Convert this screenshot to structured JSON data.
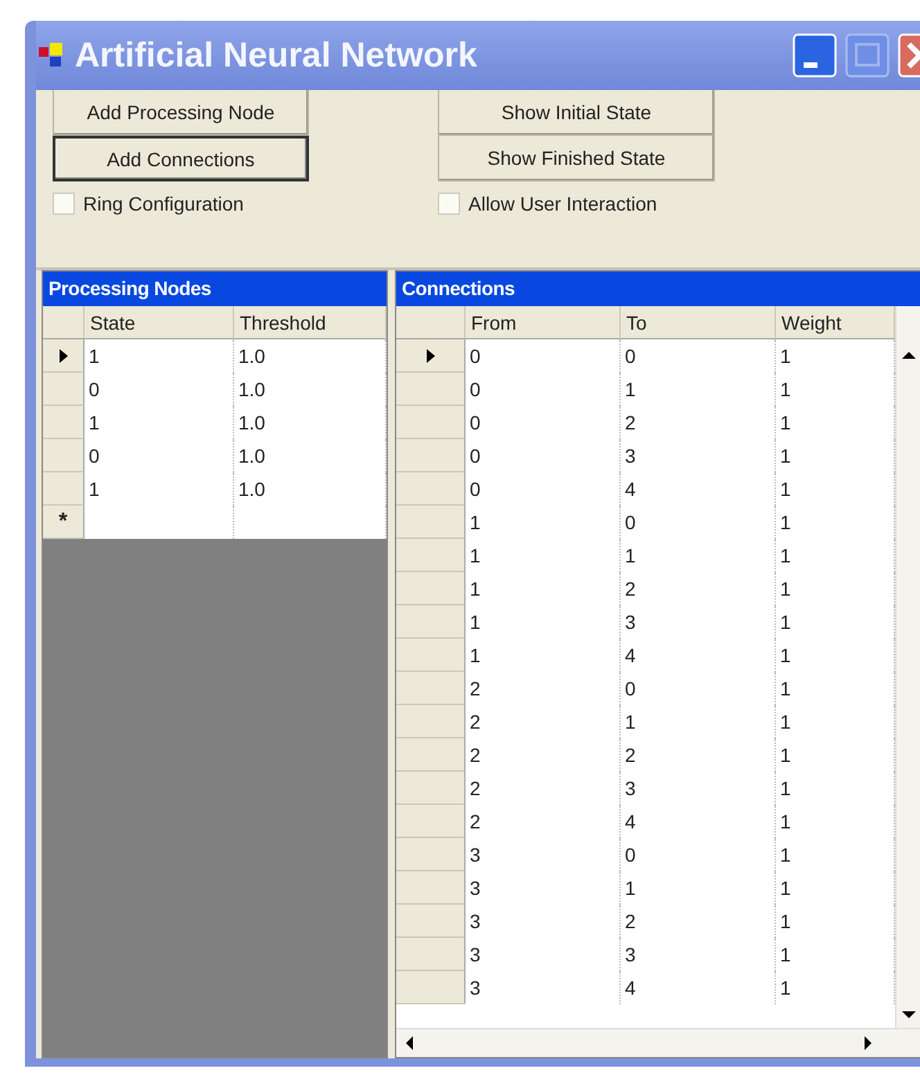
{
  "window": {
    "title": "Artificial Neural Network"
  },
  "control_groups": [
    {
      "buttons": [
        {
          "label": "Add Processing Node",
          "focused": false
        },
        {
          "label": "Add Connections",
          "focused": true
        }
      ],
      "checkbox": {
        "label": "Ring Configuration",
        "checked": false
      }
    },
    {
      "buttons": [
        {
          "label": "Show Initial State",
          "focused": false
        },
        {
          "label": "Show Finished State",
          "focused": false
        }
      ],
      "checkbox": {
        "label": "Allow User Interaction",
        "checked": false
      }
    }
  ],
  "processing_nodes": {
    "title": "Processing Nodes",
    "columns": [
      "State",
      "Threshold"
    ],
    "new_row_marker": "*",
    "rows": [
      {
        "selected": true,
        "cells": [
          "1",
          "1.0"
        ]
      },
      {
        "selected": false,
        "cells": [
          "0",
          "1.0"
        ]
      },
      {
        "selected": false,
        "cells": [
          "1",
          "1.0"
        ]
      },
      {
        "selected": false,
        "cells": [
          "0",
          "1.0"
        ]
      },
      {
        "selected": false,
        "cells": [
          "1",
          "1.0"
        ]
      }
    ]
  },
  "connections": {
    "title": "Connections",
    "columns": [
      "From",
      "To",
      "Weight"
    ],
    "rows": [
      {
        "selected": true,
        "cells": [
          "0",
          "0",
          "1"
        ]
      },
      {
        "selected": false,
        "cells": [
          "0",
          "1",
          "1"
        ]
      },
      {
        "selected": false,
        "cells": [
          "0",
          "2",
          "1"
        ]
      },
      {
        "selected": false,
        "cells": [
          "0",
          "3",
          "1"
        ]
      },
      {
        "selected": false,
        "cells": [
          "0",
          "4",
          "1"
        ]
      },
      {
        "selected": false,
        "cells": [
          "1",
          "0",
          "1"
        ]
      },
      {
        "selected": false,
        "cells": [
          "1",
          "1",
          "1"
        ]
      },
      {
        "selected": false,
        "cells": [
          "1",
          "2",
          "1"
        ]
      },
      {
        "selected": false,
        "cells": [
          "1",
          "3",
          "1"
        ]
      },
      {
        "selected": false,
        "cells": [
          "1",
          "4",
          "1"
        ]
      },
      {
        "selected": false,
        "cells": [
          "2",
          "0",
          "1"
        ]
      },
      {
        "selected": false,
        "cells": [
          "2",
          "1",
          "1"
        ]
      },
      {
        "selected": false,
        "cells": [
          "2",
          "2",
          "1"
        ]
      },
      {
        "selected": false,
        "cells": [
          "2",
          "3",
          "1"
        ]
      },
      {
        "selected": false,
        "cells": [
          "2",
          "4",
          "1"
        ]
      },
      {
        "selected": false,
        "cells": [
          "3",
          "0",
          "1"
        ]
      },
      {
        "selected": false,
        "cells": [
          "3",
          "1",
          "1"
        ]
      },
      {
        "selected": false,
        "cells": [
          "3",
          "2",
          "1"
        ]
      },
      {
        "selected": false,
        "cells": [
          "3",
          "3",
          "1"
        ]
      },
      {
        "selected": false,
        "cells": [
          "3",
          "4",
          "1"
        ]
      }
    ]
  }
}
